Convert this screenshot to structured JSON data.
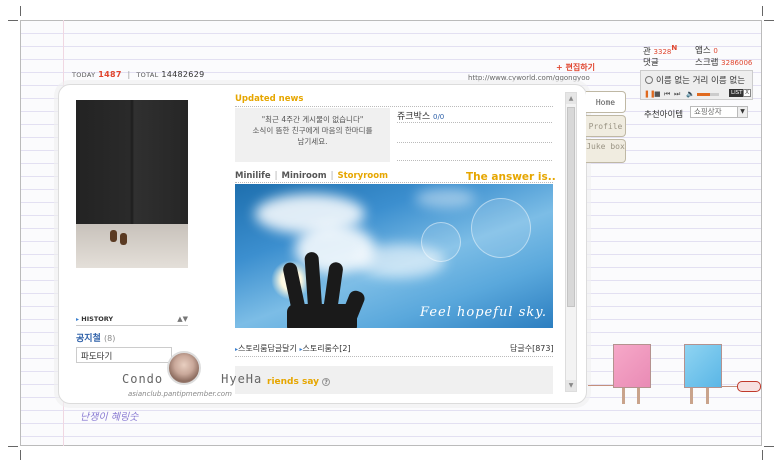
{
  "header": {
    "today_label": "TODAY",
    "today_value": "1487",
    "total_label": "TOTAL",
    "total_value": "14482629",
    "edit_link": "+ 편집하기",
    "url": "http://www.cyworld.com/ggongyoo"
  },
  "profile": {
    "history_label": "HISTORY",
    "notice_label": "공지철",
    "notice_count": "(8)",
    "dropdown_value": "파도타기"
  },
  "updated_news": {
    "title": "Updated news",
    "message_line1": "\"최근 4주간 게시물이 없습니다\"",
    "message_line2": "소식이 뜸한 친구에게 마음의 한마디를",
    "message_line3": "남기세요."
  },
  "jukebox": {
    "label": "쥬크박스",
    "count": "0/0"
  },
  "tabs": [
    {
      "label": "Minilife"
    },
    {
      "label": "Miniroom"
    },
    {
      "label": "Storyroom"
    }
  ],
  "answer_label": "The answer is..",
  "sky_caption": "Feel hopeful sky.",
  "story_links": {
    "reply_link": "스토리룸답글달기",
    "story_count_link": "스토리룸수[2]",
    "reply_count": "답글수[873]"
  },
  "friends": {
    "title": "riends say",
    "help_icon_text": "?"
  },
  "side_tabs": [
    {
      "label": "Home"
    },
    {
      "label": "Profile"
    },
    {
      "label": "Juke box"
    }
  ],
  "widget": {
    "il_chon_label": "관",
    "il_chon_value": "3328",
    "new_badge": "N",
    "apps_label": "앱스",
    "apps_value": "0",
    "comments_label": "댓글",
    "scrap_label": "스크랩",
    "scrap_value": "3286006",
    "player_title": "이름 없는 거리 이름 없는",
    "volume_level": 0.6,
    "list_button": "LIST",
    "close_button": "X",
    "recommend_label": "추천아이템",
    "shop_select": "쇼핑상자"
  },
  "footer": {
    "condo_left": "Condo",
    "condo_right": "HyeHa",
    "condo_url": "asianclub.pantipmember.com",
    "signature": "난쟁이 혜링숫"
  },
  "colors": {
    "accent_orange": "#e6a600",
    "accent_red": "#e0462f",
    "link_blue": "#2c5fa8"
  }
}
